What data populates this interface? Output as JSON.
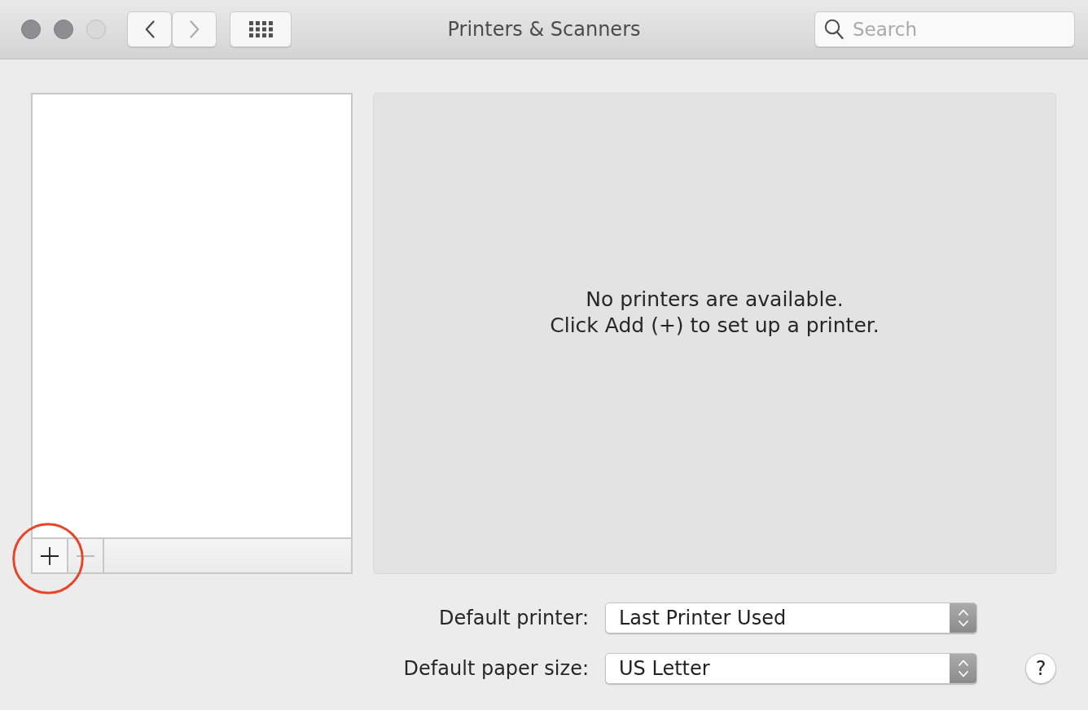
{
  "window": {
    "title": "Printers & Scanners",
    "controls": [
      {
        "disabled": false
      },
      {
        "disabled": false
      },
      {
        "disabled": true
      }
    ]
  },
  "toolbar": {
    "nav_buttons": [
      {
        "kind": "back",
        "disabled": false
      },
      {
        "kind": "forward",
        "disabled": true
      }
    ],
    "search": {
      "placeholder": "Search"
    }
  },
  "printer_list": {
    "add_button": {
      "disabled": false,
      "circled": true
    },
    "remove_button": {
      "disabled": true
    }
  },
  "details": {
    "message": [
      "No printers are available.",
      "Click Add (+) to set up a printer."
    ]
  },
  "defaults": [
    {
      "label": "Default printer:",
      "value": "Last Printer Used"
    },
    {
      "label": "Default paper size:",
      "value": "US Letter"
    }
  ],
  "help_button": {
    "label": "?"
  }
}
